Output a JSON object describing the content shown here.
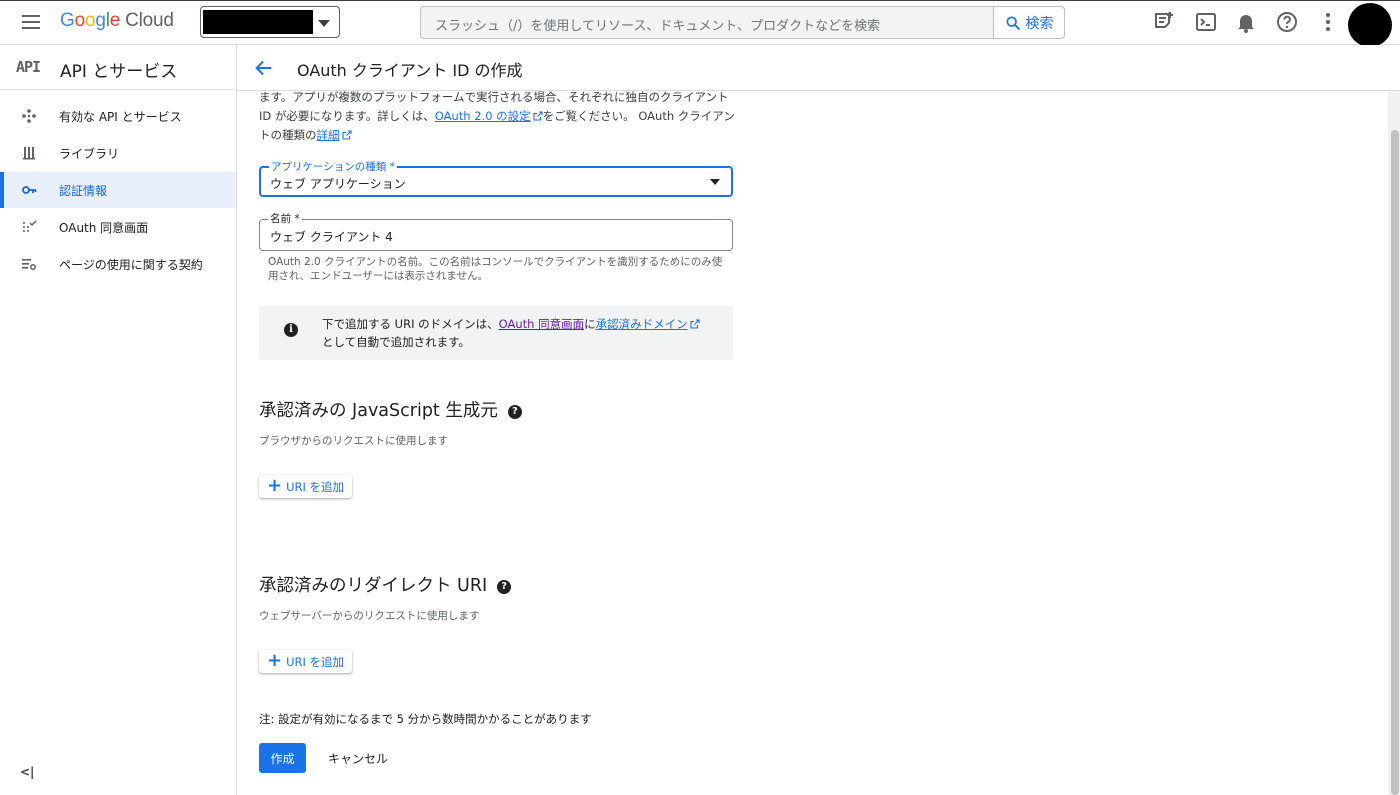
{
  "topbar": {
    "logo_google": [
      "G",
      "o",
      "o",
      "g",
      "l",
      "e"
    ],
    "logo_cloud": "Cloud",
    "search_placeholder": "スラッシュ（/）を使用してリソース、ドキュメント、プロダクトなどを検索",
    "search_button": "検索",
    "icons": [
      "menu-icon",
      "notes-icon",
      "terminal-icon",
      "bell-icon",
      "help-icon",
      "more-vert-icon",
      "avatar"
    ]
  },
  "sidebar": {
    "api_mark": "API",
    "title": "API とサービス",
    "items": [
      {
        "label": "有効な API とサービス",
        "icon": "apps-move-icon",
        "active": false
      },
      {
        "label": "ライブラリ",
        "icon": "library-icon",
        "active": true
      },
      {
        "label": "認証情報",
        "icon": "key-icon",
        "active": true
      },
      {
        "label": "OAuth 同意画面",
        "icon": "consent-icon",
        "active": false
      },
      {
        "label": "ページの使用に関する契約",
        "icon": "settings-list-icon",
        "active": false
      }
    ],
    "collapse_label": "<|"
  },
  "header": {
    "title": "OAuth クライアント ID の作成"
  },
  "intro": {
    "line_part1": "ます。アプリが複数のプラットフォームで実行される場合、それぞれに独自のクライアント ID が必要になります。詳しくは、",
    "link1": "OAuth 2.0 の設定",
    "line_part2": "をご覧ください。 OAuth クライアントの種類の",
    "link2": "詳細"
  },
  "app_type": {
    "label": "アプリケーションの種類 *",
    "value": "ウェブ アプリケーション"
  },
  "name_field": {
    "label": "名前 *",
    "value": "ウェブ クライアント 4",
    "hint": "OAuth 2.0 クライアントの名前。この名前はコンソールでクライアントを識別するためにのみ使用され、エンドユーザーには表示されません。"
  },
  "info": {
    "part1": "下で追加する URI のドメインは、",
    "link1": "OAuth 同意画面",
    "part2": "に",
    "link2": "承認済みドメイン",
    "part3": "として自動で追加されます。"
  },
  "js_origins": {
    "title": "承認済みの JavaScript 生成元",
    "desc": "ブラウザからのリクエストに使用します",
    "add_button": "URI を追加"
  },
  "redirect_uris": {
    "title": "承認済みのリダイレクト URI",
    "desc": "ウェブサーバーからのリクエストに使用します",
    "add_button": "URI を追加"
  },
  "note": "注: 設定が有効になるまで 5 分から数時間かかることがあります",
  "actions": {
    "create": "作成",
    "cancel": "キャンセル"
  },
  "colors": {
    "accent": "#1a73e8",
    "active_nav_bg": "#e8f0fe",
    "visited_link": "#681da8"
  }
}
